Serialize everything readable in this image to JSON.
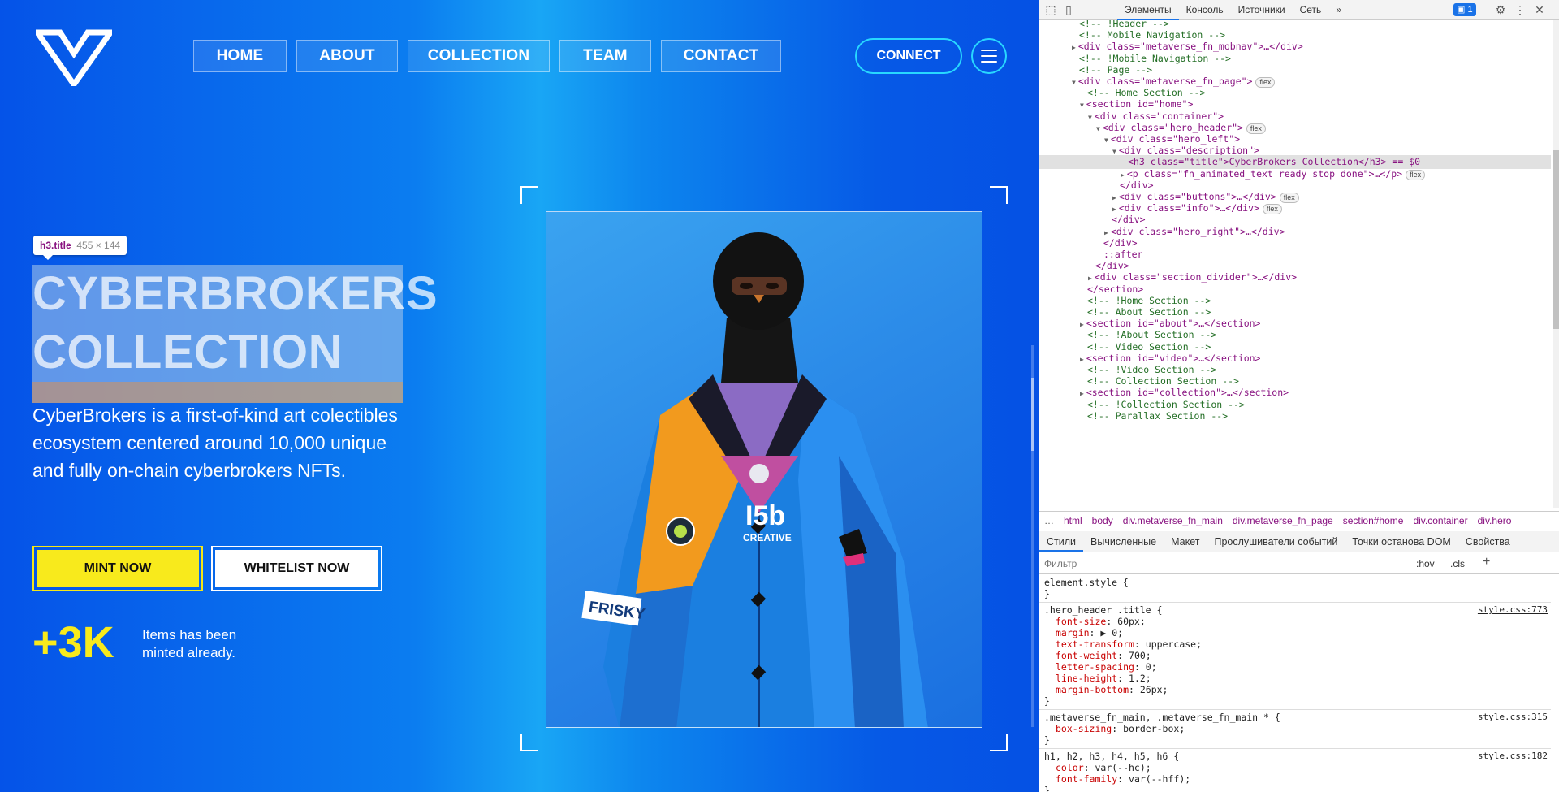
{
  "page": {
    "nav": [
      "HOME",
      "ABOUT",
      "COLLECTION",
      "TEAM",
      "CONTACT"
    ],
    "connect_label": "CONNECT",
    "tooltip": {
      "selector": "h3.title",
      "size": "455 × 144"
    },
    "title": "CyberBrokers Collection",
    "description": "CyberBrokers is a first-of-kind art colectibles ecosystem centered around 10,000 unique and fully on-chain cyberbrokers NFTs.",
    "mint_label": "MINT NOW",
    "whitelist_label": "WHITELIST NOW",
    "stat_number": "+3K",
    "stat_text": "Items has been minted already.",
    "art_text": {
      "patch_left": "FRISKY",
      "patch_right_top": "I5b",
      "patch_right_bottom": "CREATIVE"
    }
  },
  "devtools": {
    "tabs": [
      "Элементы",
      "Консоль",
      "Источники",
      "Сеть"
    ],
    "issues_count": "1",
    "dom_lines": [
      {
        "indent": 4,
        "text": "<!-- !Header -->",
        "type": "cm"
      },
      {
        "indent": 4,
        "text": "<!-- Mobile Navigation -->",
        "type": "cm"
      },
      {
        "indent": 4,
        "text": "<div class=\"metaverse_fn_mobnav\">…</div>",
        "type": "tg",
        "arrow": "▶"
      },
      {
        "indent": 4,
        "text": "<!-- !Mobile Navigation -->",
        "type": "cm"
      },
      {
        "indent": 4,
        "text": "<!-- Page -->",
        "type": "cm"
      },
      {
        "indent": 4,
        "text": "<div class=\"metaverse_fn_page\">",
        "type": "tg",
        "arrow": "▼",
        "flex": "flex"
      },
      {
        "indent": 5,
        "text": "<!-- Home Section -->",
        "type": "cm"
      },
      {
        "indent": 5,
        "text": "<section id=\"home\">",
        "type": "tg",
        "arrow": "▼"
      },
      {
        "indent": 6,
        "text": "<div class=\"container\">",
        "type": "tg",
        "arrow": "▼"
      },
      {
        "indent": 7,
        "text": "<div class=\"hero_header\">",
        "type": "tg",
        "arrow": "▼",
        "flex": "flex"
      },
      {
        "indent": 8,
        "text": "<div class=\"hero_left\">",
        "type": "tg",
        "arrow": "▼"
      },
      {
        "indent": 9,
        "text": "<div class=\"description\">",
        "type": "tg",
        "arrow": "▼"
      },
      {
        "indent": 10,
        "text": "<h3 class=\"title\">CyberBrokers Collection</h3> == $0",
        "type": "tg",
        "selected": true
      },
      {
        "indent": 10,
        "text": "<p class=\"fn_animated_text ready stop done\">…</p>",
        "type": "tg",
        "arrow": "▶",
        "flex": "flex"
      },
      {
        "indent": 9,
        "text": "</div>",
        "type": "tg"
      },
      {
        "indent": 9,
        "text": "<div class=\"buttons\">…</div>",
        "type": "tg",
        "arrow": "▶",
        "flex": "flex"
      },
      {
        "indent": 9,
        "text": "<div class=\"info\">…</div>",
        "type": "tg",
        "arrow": "▶",
        "flex": "flex"
      },
      {
        "indent": 8,
        "text": "</div>",
        "type": "tg"
      },
      {
        "indent": 8,
        "text": "<div class=\"hero_right\">…</div>",
        "type": "tg",
        "arrow": "▶"
      },
      {
        "indent": 7,
        "text": "</div>",
        "type": "tg"
      },
      {
        "indent": 7,
        "text": "::after",
        "type": "tg"
      },
      {
        "indent": 6,
        "text": "</div>",
        "type": "tg"
      },
      {
        "indent": 6,
        "text": "<div class=\"section_divider\">…</div>",
        "type": "tg",
        "arrow": "▶"
      },
      {
        "indent": 5,
        "text": "</section>",
        "type": "tg"
      },
      {
        "indent": 5,
        "text": "<!-- !Home Section -->",
        "type": "cm"
      },
      {
        "indent": 5,
        "text": "<!-- About Section -->",
        "type": "cm"
      },
      {
        "indent": 5,
        "text": "<section id=\"about\">…</section>",
        "type": "tg",
        "arrow": "▶"
      },
      {
        "indent": 5,
        "text": "<!-- !About Section -->",
        "type": "cm"
      },
      {
        "indent": 5,
        "text": "<!-- Video Section -->",
        "type": "cm"
      },
      {
        "indent": 5,
        "text": "<section id=\"video\">…</section>",
        "type": "tg",
        "arrow": "▶"
      },
      {
        "indent": 5,
        "text": "<!-- !Video Section -->",
        "type": "cm"
      },
      {
        "indent": 5,
        "text": "<!-- Collection Section -->",
        "type": "cm"
      },
      {
        "indent": 5,
        "text": "<section id=\"collection\">…</section>",
        "type": "tg",
        "arrow": "▶"
      },
      {
        "indent": 5,
        "text": "<!-- !Collection Section -->",
        "type": "cm"
      },
      {
        "indent": 5,
        "text": "<!-- Parallax Section -->",
        "type": "cm"
      }
    ],
    "breadcrumbs": [
      "…",
      "html",
      "body",
      "div.metaverse_fn_main",
      "div.metaverse_fn_page",
      "section#home",
      "div.container",
      "div.hero"
    ],
    "subtabs": [
      "Стили",
      "Вычисленные",
      "Макет",
      "Прослушиватели событий",
      "Точки останова DOM",
      "Свойства"
    ],
    "filter_placeholder": "Фильтр",
    "hov": ":hov",
    "cls": ".cls",
    "styles": [
      {
        "selector": "element.style {",
        "source": "",
        "props": []
      },
      {
        "selector": ".hero_header .title {",
        "source": "style.css:773",
        "props": [
          [
            "font-size",
            "60px;"
          ],
          [
            "margin",
            "▶ 0;"
          ],
          [
            "text-transform",
            "uppercase;"
          ],
          [
            "font-weight",
            "700;"
          ],
          [
            "letter-spacing",
            "0;"
          ],
          [
            "line-height",
            "1.2;"
          ],
          [
            "margin-bottom",
            "26px;"
          ]
        ]
      },
      {
        "selector": ".metaverse_fn_main, .metaverse_fn_main * {",
        "source": "style.css:315",
        "props": [
          [
            "box-sizing",
            "border-box;"
          ]
        ]
      },
      {
        "selector": "h1, h2, h3, h4, h5, h6 {",
        "source": "style.css:182",
        "props": [
          [
            "color",
            "var(--hc);"
          ],
          [
            "font-family",
            "var(--hff);"
          ]
        ]
      }
    ]
  }
}
